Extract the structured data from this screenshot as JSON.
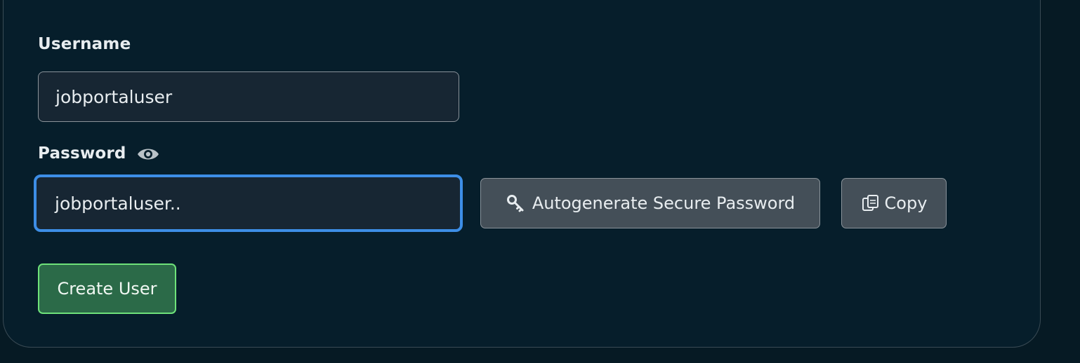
{
  "form": {
    "username_label": "Username",
    "username_value": "jobportaluser",
    "password_label": "Password",
    "password_value": "jobportaluser..",
    "autogenerate_label": "Autogenerate Secure Password",
    "copy_label": "Copy",
    "create_label": "Create User"
  },
  "icons": {
    "password_visibility": "eye-icon",
    "autogenerate": "key-icon",
    "copy": "copy-icon"
  },
  "colors": {
    "background": "#061a24",
    "focus_border": "#3d8ee6",
    "primary_button": "#2b6a48",
    "primary_border": "#6ee27a",
    "secondary_button": "#444f58"
  }
}
